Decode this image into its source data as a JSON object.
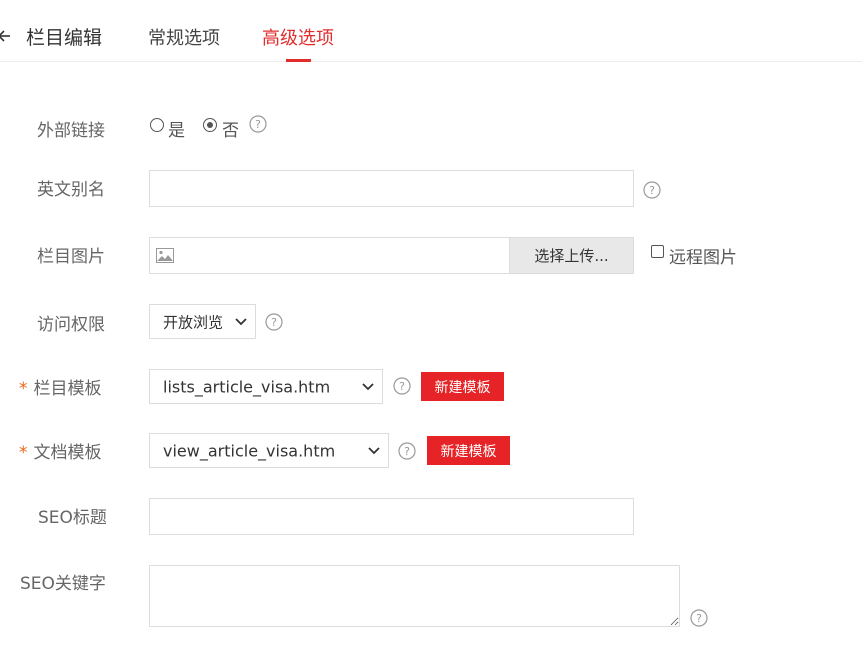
{
  "header": {
    "title": "栏目编辑",
    "tabs": [
      {
        "label": "常规选项",
        "active": false
      },
      {
        "label": "高级选项",
        "active": true
      }
    ]
  },
  "form": {
    "external_link": {
      "label": "外部链接",
      "options": [
        {
          "label": "是",
          "checked": false
        },
        {
          "label": "否",
          "checked": true
        }
      ]
    },
    "english_alias": {
      "label": "英文别名",
      "value": ""
    },
    "column_image": {
      "label": "栏目图片",
      "upload_label": "选择上传...",
      "remote_label": "远程图片",
      "remote_checked": false
    },
    "access": {
      "label": "访问权限",
      "selected": "开放浏览"
    },
    "column_template": {
      "required_mark": "*",
      "label": "栏目模板",
      "selected": "lists_article_visa.htm",
      "new_button": "新建模板"
    },
    "doc_template": {
      "required_mark": "*",
      "label": "文档模板",
      "selected": "view_article_visa.htm",
      "new_button": "新建模板"
    },
    "seo_title": {
      "label": "SEO标题",
      "value": ""
    },
    "seo_keywords": {
      "label": "SEO关键字",
      "value": ""
    }
  },
  "colors": {
    "accent": "#e22d2d",
    "button_red": "#e62326",
    "required": "#e8661b"
  }
}
